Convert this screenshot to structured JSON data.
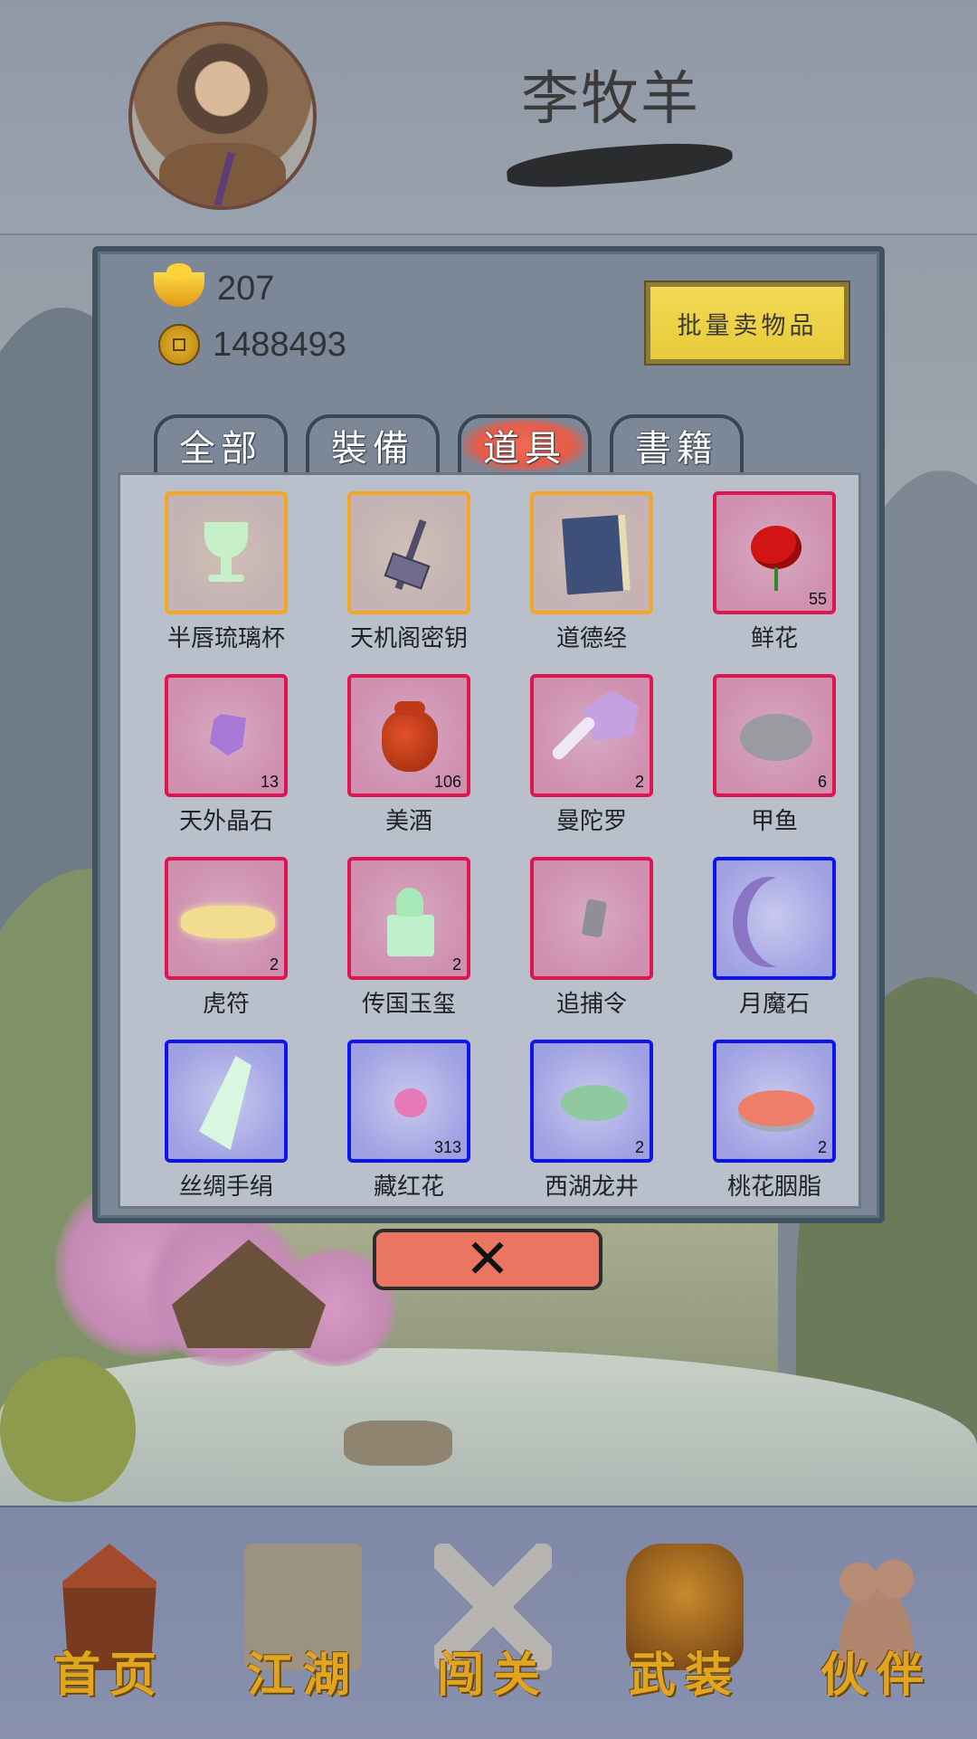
{
  "header": {
    "player_name": "李牧羊"
  },
  "currency": {
    "gold_ingots": "207",
    "coins": "1488493"
  },
  "toolbar": {
    "sell_label": "批量卖物品"
  },
  "tabs": [
    {
      "label": "全部",
      "active": false
    },
    {
      "label": "裝備",
      "active": false
    },
    {
      "label": "道具",
      "active": true
    },
    {
      "label": "書籍",
      "active": false
    }
  ],
  "items": [
    {
      "name": "半唇琉璃杯",
      "count": "",
      "rarity": "orange"
    },
    {
      "name": "天机阁密钥",
      "count": "",
      "rarity": "orange"
    },
    {
      "name": "道德经",
      "count": "",
      "rarity": "orange"
    },
    {
      "name": "鲜花",
      "count": "55",
      "rarity": "red"
    },
    {
      "name": "天外晶石",
      "count": "13",
      "rarity": "red"
    },
    {
      "name": "美酒",
      "count": "106",
      "rarity": "red"
    },
    {
      "name": "曼陀罗",
      "count": "2",
      "rarity": "red"
    },
    {
      "name": "甲鱼",
      "count": "6",
      "rarity": "red"
    },
    {
      "name": "虎符",
      "count": "2",
      "rarity": "red"
    },
    {
      "name": "传国玉玺",
      "count": "2",
      "rarity": "red"
    },
    {
      "name": "追捕令",
      "count": "",
      "rarity": "red"
    },
    {
      "name": "月魔石",
      "count": "",
      "rarity": "blue"
    },
    {
      "name": "丝绸手绢",
      "count": "",
      "rarity": "blue"
    },
    {
      "name": "藏红花",
      "count": "313",
      "rarity": "blue"
    },
    {
      "name": "西湖龙井",
      "count": "2",
      "rarity": "blue"
    },
    {
      "name": "桃花胭脂",
      "count": "2",
      "rarity": "blue"
    }
  ],
  "close_label": "✕",
  "nav": [
    {
      "label": "首页"
    },
    {
      "label": "江湖"
    },
    {
      "label": "闯关"
    },
    {
      "label": "武装"
    },
    {
      "label": "伙伴"
    }
  ],
  "colors": {
    "rarity_orange": "#f5a623",
    "rarity_red": "#dd1551",
    "rarity_blue": "#0e14ee",
    "sell_button": "#eed04a",
    "close_button": "#ea7560",
    "nav_label": "#e3a51f"
  }
}
